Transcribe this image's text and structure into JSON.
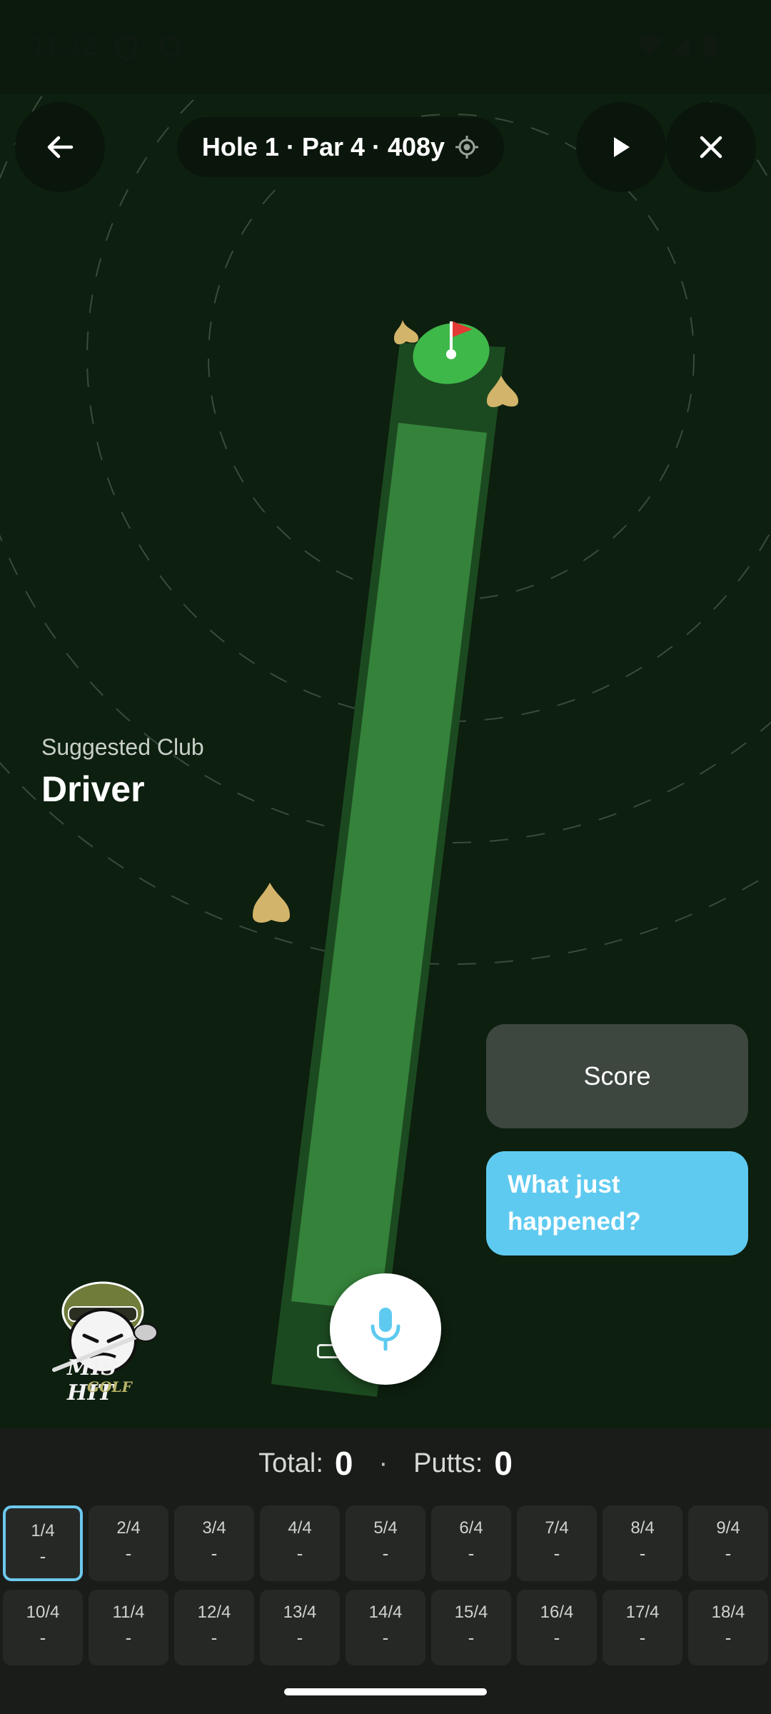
{
  "status_bar": {
    "time": "11:12"
  },
  "header": {
    "back_icon": "arrow-left-icon",
    "hole_info": "Hole 1 · Par 4 · 408y",
    "locate_icon": "crosshair-icon",
    "play_icon": "play-icon",
    "close_icon": "close-icon"
  },
  "suggestion": {
    "label": "Suggested Club",
    "club": "Driver"
  },
  "actions": {
    "score_label": "Score",
    "what_happened_line1": "What just",
    "what_happened_line2": "happened?",
    "mic_icon": "microphone-icon"
  },
  "logo": {
    "line1": "MIS HIT",
    "line2": "GOLF"
  },
  "totals": {
    "total_label": "Total:",
    "total_value": "0",
    "separator": "·",
    "putts_label": "Putts:",
    "putts_value": "0"
  },
  "holes": [
    {
      "label": "1/4",
      "score": "-"
    },
    {
      "label": "2/4",
      "score": "-"
    },
    {
      "label": "3/4",
      "score": "-"
    },
    {
      "label": "4/4",
      "score": "-"
    },
    {
      "label": "5/4",
      "score": "-"
    },
    {
      "label": "6/4",
      "score": "-"
    },
    {
      "label": "7/4",
      "score": "-"
    },
    {
      "label": "8/4",
      "score": "-"
    },
    {
      "label": "9/4",
      "score": "-"
    },
    {
      "label": "10/4",
      "score": "-"
    },
    {
      "label": "11/4",
      "score": "-"
    },
    {
      "label": "12/4",
      "score": "-"
    },
    {
      "label": "13/4",
      "score": "-"
    },
    {
      "label": "14/4",
      "score": "-"
    },
    {
      "label": "15/4",
      "score": "-"
    },
    {
      "label": "16/4",
      "score": "-"
    },
    {
      "label": "17/4",
      "score": "-"
    },
    {
      "label": "18/4",
      "score": "-"
    }
  ],
  "selected_hole": 1,
  "colors": {
    "accent": "#6cc8ee",
    "what_happened_bg": "#5fcaf0",
    "score_bg": "#3d463f",
    "map_bg": "#0d1f0f",
    "fairway": "#35823a",
    "green": "#3fb84a",
    "bunker": "#d2b46a",
    "flag": "#e53935"
  }
}
